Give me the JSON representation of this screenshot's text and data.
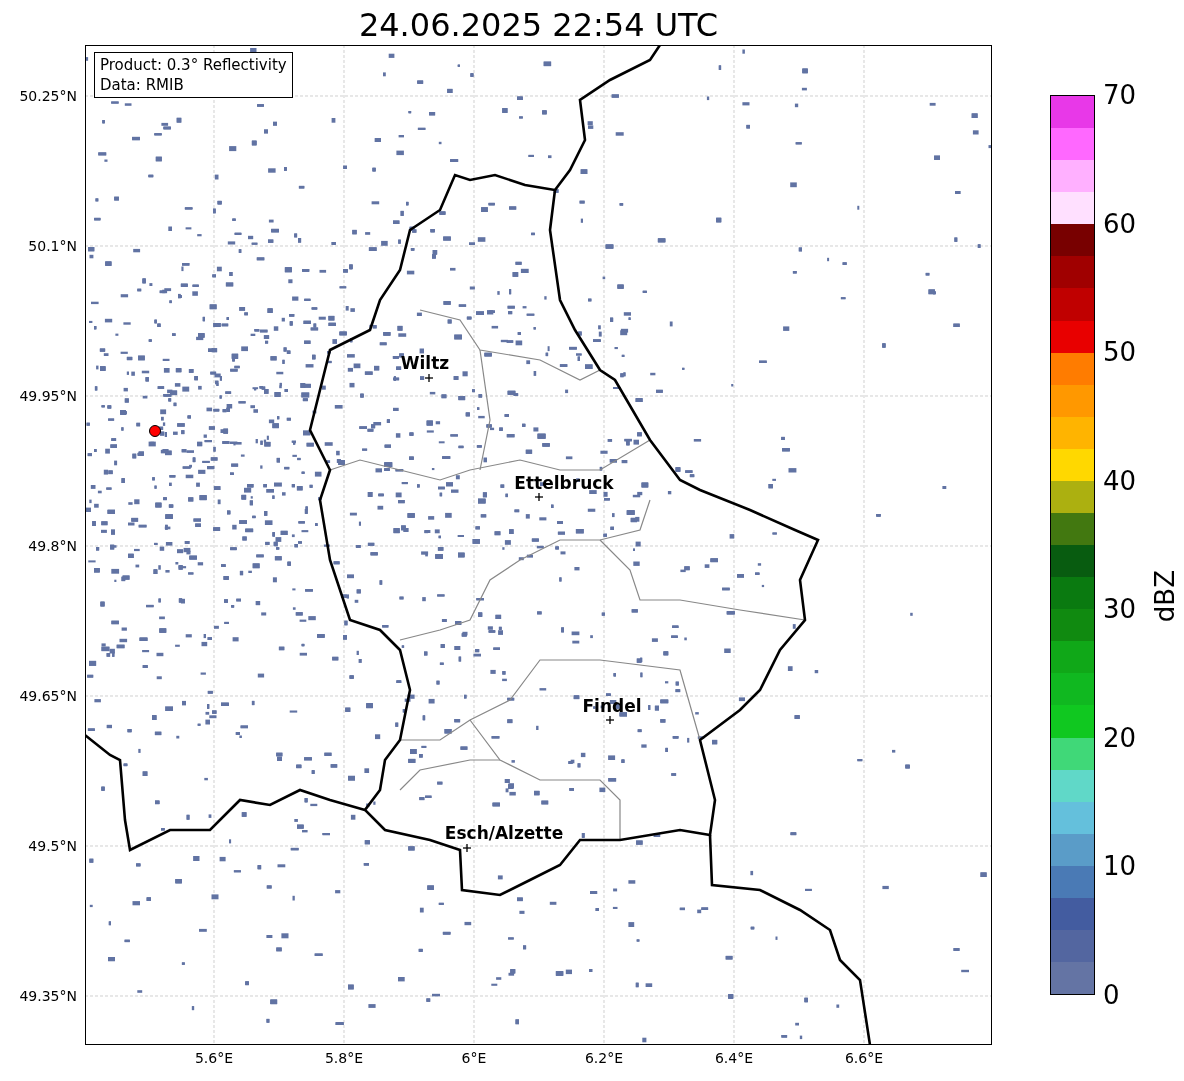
{
  "title": "24.06.2025 22:54 UTC",
  "info_box": {
    "lines": [
      "Product: 0.3° Reflectivity",
      "Data: RMIB"
    ]
  },
  "map": {
    "lat_ticks": [
      "50.25°N",
      "50.1°N",
      "49.95°N",
      "49.8°N",
      "49.65°N",
      "49.5°N",
      "49.35°N"
    ],
    "lon_ticks": [
      "5.6°E",
      "5.8°E",
      "6°E",
      "6.2°E",
      "6.4°E",
      "6.6°E"
    ],
    "cities": [
      {
        "name": "Wiltz"
      },
      {
        "name": "Ettelbruck"
      },
      {
        "name": "Findel"
      },
      {
        "name": "Esch/Alzette"
      }
    ]
  },
  "colorbar": {
    "label": "dBZ",
    "ticks": [
      "70",
      "60",
      "50",
      "40",
      "30",
      "20",
      "10",
      "0"
    ],
    "bands": [
      {
        "color": "#6474a4"
      },
      {
        "color": "#5366a0"
      },
      {
        "color": "#435ca0"
      },
      {
        "color": "#4a7ab5"
      },
      {
        "color": "#5a9cc8"
      },
      {
        "color": "#64c0dc"
      },
      {
        "color": "#60d8c8"
      },
      {
        "color": "#40d878"
      },
      {
        "color": "#10c820"
      },
      {
        "color": "#10b820"
      },
      {
        "color": "#10a818"
      },
      {
        "color": "#108a10"
      },
      {
        "color": "#0a7a10"
      },
      {
        "color": "#085c10"
      },
      {
        "color": "#427810"
      },
      {
        "color": "#acb010"
      },
      {
        "color": "#ffd800"
      },
      {
        "color": "#ffb400"
      },
      {
        "color": "#ff9800"
      },
      {
        "color": "#ff7c00"
      },
      {
        "color": "#e80000"
      },
      {
        "color": "#c00000"
      },
      {
        "color": "#a00000"
      },
      {
        "color": "#780000"
      },
      {
        "color": "#ffe0ff"
      },
      {
        "color": "#ffb0ff"
      },
      {
        "color": "#ff68ff"
      },
      {
        "color": "#e838e8"
      }
    ]
  }
}
